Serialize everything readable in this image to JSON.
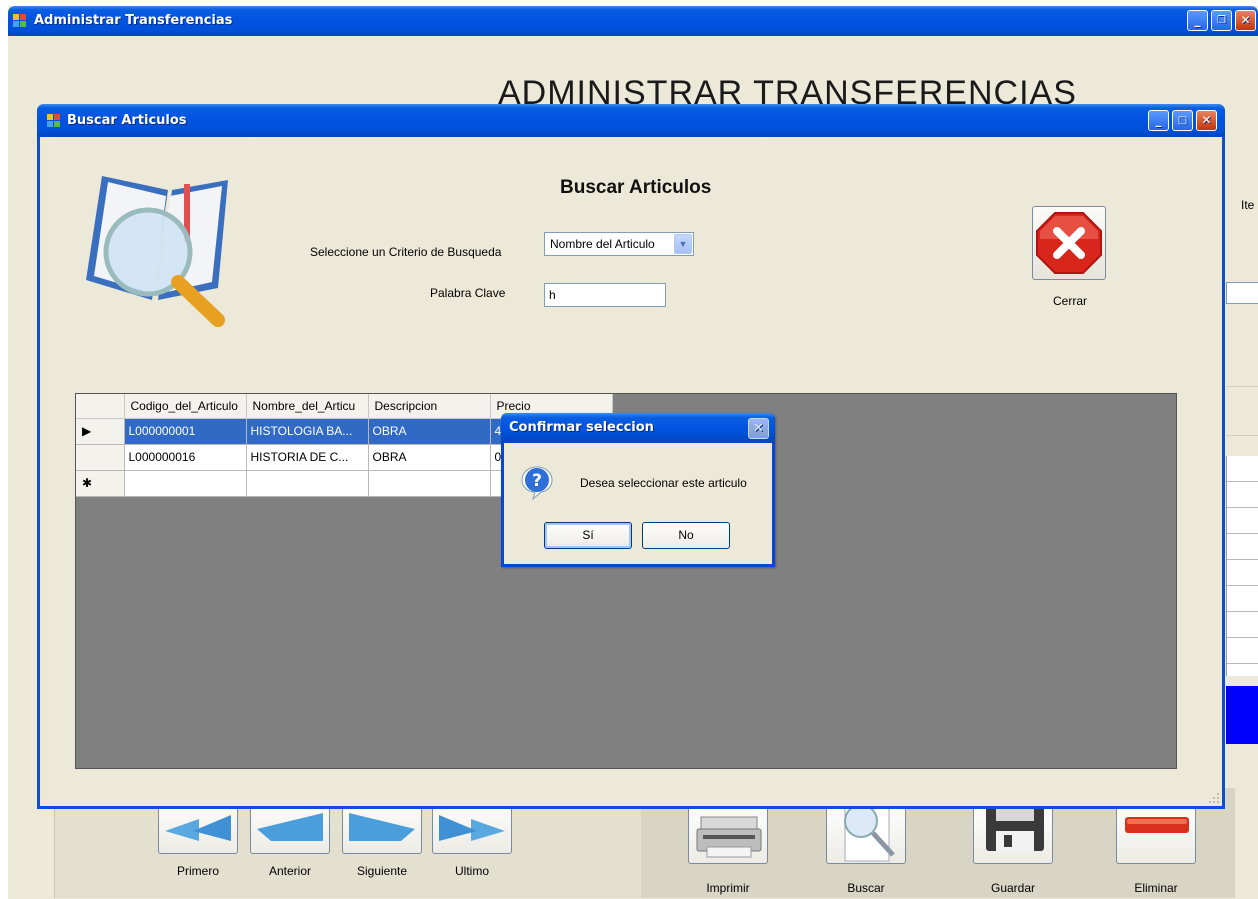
{
  "main_window": {
    "title": "Administrar Transferencias",
    "heading": "ADMINISTRAR TRANSFERENCIAS",
    "right_peek_label": "Ite",
    "nav_buttons": [
      {
        "label": "Primero",
        "icon": "double-left-arrow-icon"
      },
      {
        "label": "Anterior",
        "icon": "left-arrow-icon"
      },
      {
        "label": "Siguiente",
        "icon": "right-arrow-icon"
      },
      {
        "label": "Ultimo",
        "icon": "double-right-arrow-icon"
      }
    ],
    "action_buttons": [
      {
        "label": "Imprimir",
        "icon": "printer-icon"
      },
      {
        "label": "Buscar",
        "icon": "magnifier-icon"
      },
      {
        "label": "Guardar",
        "icon": "floppy-disk-icon"
      },
      {
        "label": "Eliminar",
        "icon": "minus-icon"
      }
    ]
  },
  "buscar_window": {
    "title": "Buscar Articulos",
    "form_title": "Buscar Articulos",
    "criteria_label": "Seleccione un Criterio de Busqueda",
    "criteria_selected": "Nombre del Articulo",
    "keyword_label": "Palabra Clave",
    "keyword_value": "h",
    "close_label": "Cerrar",
    "grid": {
      "columns": [
        "Codigo_del_Articulo",
        "Nombre_del_Articulo",
        "Descripcion",
        "Precio"
      ],
      "columns_display": [
        "Codigo_del_Articulo",
        "Nombre_del_Articu",
        "Descripcion",
        "Precio"
      ],
      "rows": [
        {
          "indicator": "▶",
          "cells": [
            "L000000001",
            "HISTOLOGIA BA...",
            "OBRA",
            "4"
          ]
        },
        {
          "indicator": "",
          "cells": [
            "L000000016",
            "HISTORIA DE C...",
            "OBRA",
            "0"
          ]
        },
        {
          "indicator": "✱",
          "cells": [
            "",
            "",
            "",
            ""
          ]
        }
      ]
    }
  },
  "confirm_dialog": {
    "title": "Confirmar seleccion",
    "message": "Desea seleccionar este articulo",
    "yes_label": "Sí",
    "no_label": "No",
    "close_glyph": "✕"
  },
  "colors": {
    "xp_title_blue": "#0054e3",
    "window_bg": "#ece9d8",
    "selection_blue": "#316ac5",
    "grid_bg": "#808080"
  }
}
